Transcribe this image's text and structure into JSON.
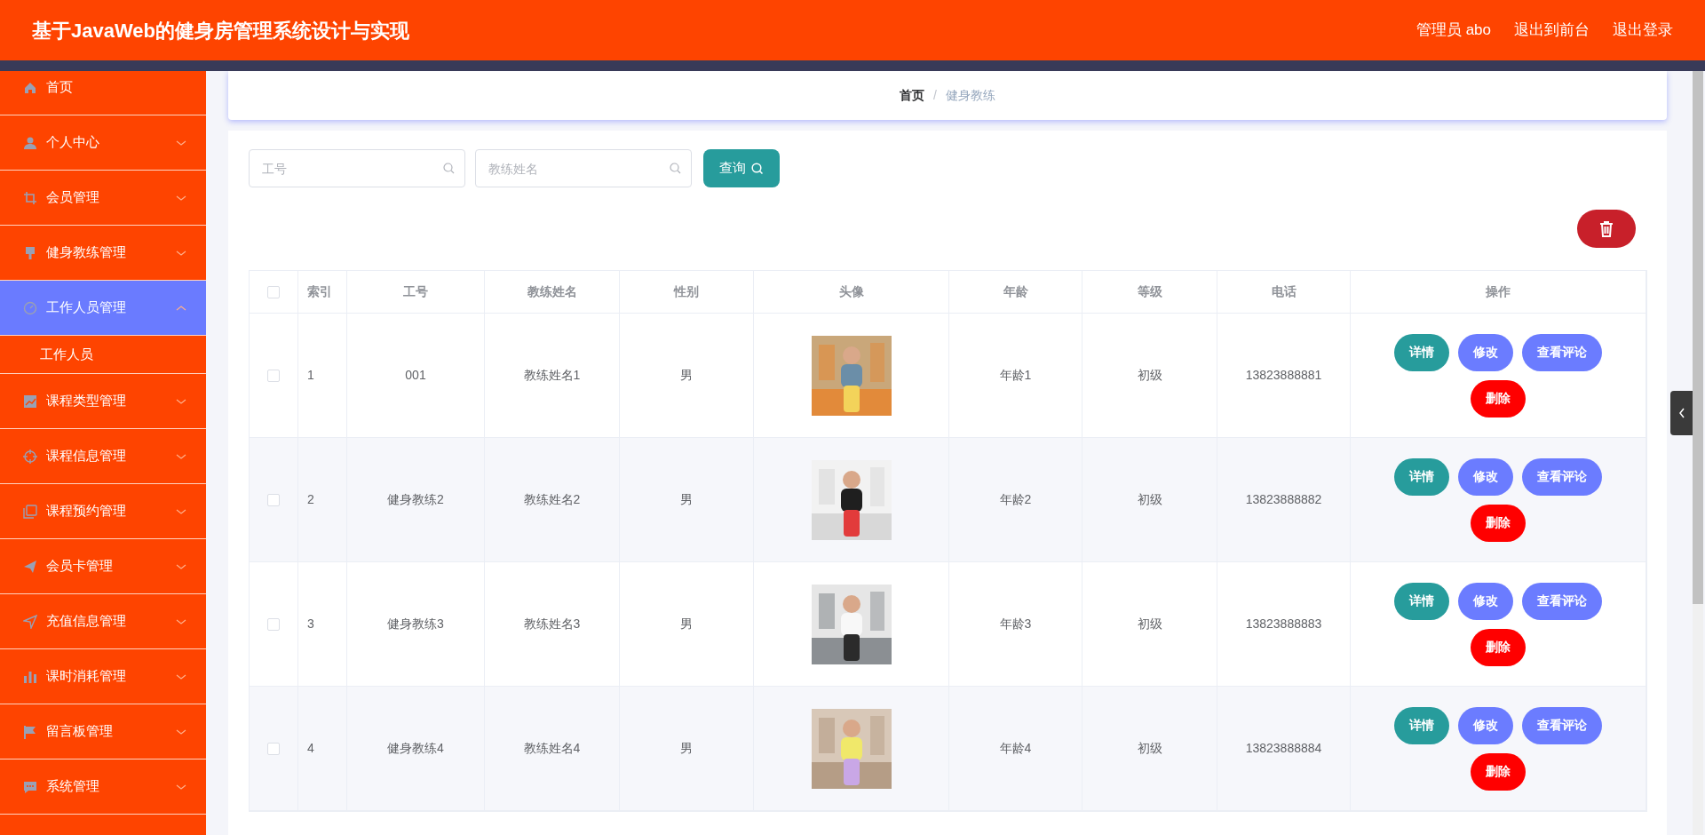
{
  "header": {
    "title": "基于JavaWeb的健身房管理系统设计与实现",
    "links": [
      "管理员 abo",
      "退出到前台",
      "退出登录"
    ]
  },
  "sidebar": {
    "items": [
      {
        "label": "首页",
        "kind": "link",
        "selected": false
      },
      {
        "label": "个人中心",
        "kind": "submenu",
        "selected": false,
        "expanded": false
      },
      {
        "label": "会员管理",
        "kind": "submenu",
        "selected": false,
        "expanded": false
      },
      {
        "label": "健身教练管理",
        "kind": "submenu",
        "selected": false,
        "expanded": false
      },
      {
        "label": "工作人员管理",
        "kind": "submenu",
        "selected": true,
        "expanded": true,
        "children": [
          {
            "label": "工作人员",
            "selected": false
          }
        ]
      },
      {
        "label": "课程类型管理",
        "kind": "submenu",
        "selected": false,
        "expanded": false
      },
      {
        "label": "课程信息管理",
        "kind": "submenu",
        "selected": false,
        "expanded": false
      },
      {
        "label": "课程预约管理",
        "kind": "submenu",
        "selected": false,
        "expanded": false
      },
      {
        "label": "会员卡管理",
        "kind": "submenu",
        "selected": false,
        "expanded": false
      },
      {
        "label": "充值信息管理",
        "kind": "submenu",
        "selected": false,
        "expanded": false
      },
      {
        "label": "课时消耗管理",
        "kind": "submenu",
        "selected": false,
        "expanded": false
      },
      {
        "label": "留言板管理",
        "kind": "submenu",
        "selected": false,
        "expanded": false
      },
      {
        "label": "系统管理",
        "kind": "submenu",
        "selected": false,
        "expanded": false
      }
    ]
  },
  "breadcrumb": {
    "items": [
      "首页",
      "健身教练"
    ],
    "separator": "/"
  },
  "search": {
    "fields": [
      {
        "placeholder": "工号"
      },
      {
        "placeholder": "教练姓名"
      }
    ],
    "button": "查询"
  },
  "table": {
    "select_all": {
      "checked": false
    },
    "columns": [
      "索引",
      "工号",
      "教练姓名",
      "性别",
      "头像",
      "年龄",
      "等级",
      "电话",
      "操作"
    ],
    "rows": [
      {
        "checked": false,
        "cells": [
          "1",
          "001",
          "教练姓名1",
          "男",
          "",
          "年龄1",
          "初级",
          "13823888881"
        ],
        "photo": {
          "kind": "picture"
        },
        "actions": [
          "详情",
          "修改",
          "查看评论",
          "删除"
        ]
      },
      {
        "checked": false,
        "cells": [
          "2",
          "健身教练2",
          "教练姓名2",
          "男",
          "",
          "年龄2",
          "初级",
          "13823888882"
        ],
        "photo": {
          "kind": "picture"
        },
        "actions": [
          "详情",
          "修改",
          "查看评论",
          "删除"
        ]
      },
      {
        "checked": false,
        "cells": [
          "3",
          "健身教练3",
          "教练姓名3",
          "男",
          "",
          "年龄3",
          "初级",
          "13823888883"
        ],
        "photo": {
          "kind": "picture"
        },
        "actions": [
          "详情",
          "修改",
          "查看评论",
          "删除"
        ]
      },
      {
        "checked": false,
        "cells": [
          "4",
          "健身教练4",
          "教练姓名4",
          "男",
          "",
          "年龄4",
          "初级",
          "13823888884"
        ],
        "photo": {
          "kind": "picture"
        },
        "actions": [
          "详情",
          "修改",
          "查看评论",
          "删除"
        ]
      }
    ]
  }
}
